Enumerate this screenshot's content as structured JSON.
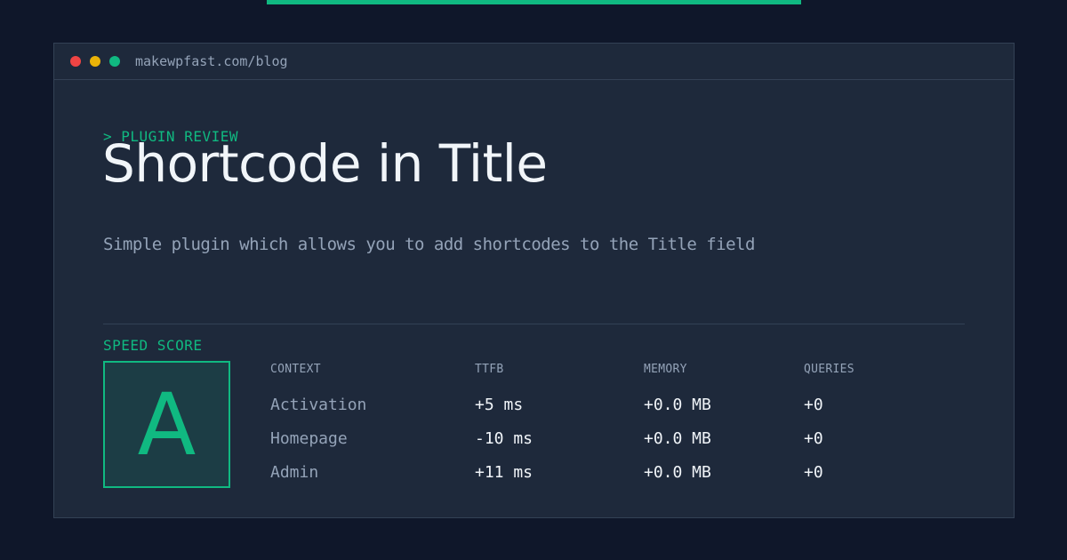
{
  "browser": {
    "url": "makewpfast.com/blog"
  },
  "article": {
    "kicker": "> PLUGIN REVIEW",
    "title": "Shortcode in Title",
    "subtitle": "Simple plugin which allows you to add shortcodes to the Title field"
  },
  "speed_score": {
    "label": "SPEED SCORE",
    "grade": "A"
  },
  "metrics": {
    "headers": [
      "CONTEXT",
      "TTFB",
      "MEMORY",
      "QUERIES"
    ],
    "rows": [
      [
        "Activation",
        "+5 ms",
        "+0.0 MB",
        "+0"
      ],
      [
        "Homepage",
        "-10 ms",
        "+0.0 MB",
        "+0"
      ],
      [
        "Admin",
        "+11 ms",
        "+0.0 MB",
        "+0"
      ]
    ]
  },
  "colors": {
    "background": "#0f172a",
    "panel": "#1e293b",
    "accent": "#10b981",
    "text": "#f1f5f9",
    "muted": "#94a3b8"
  }
}
